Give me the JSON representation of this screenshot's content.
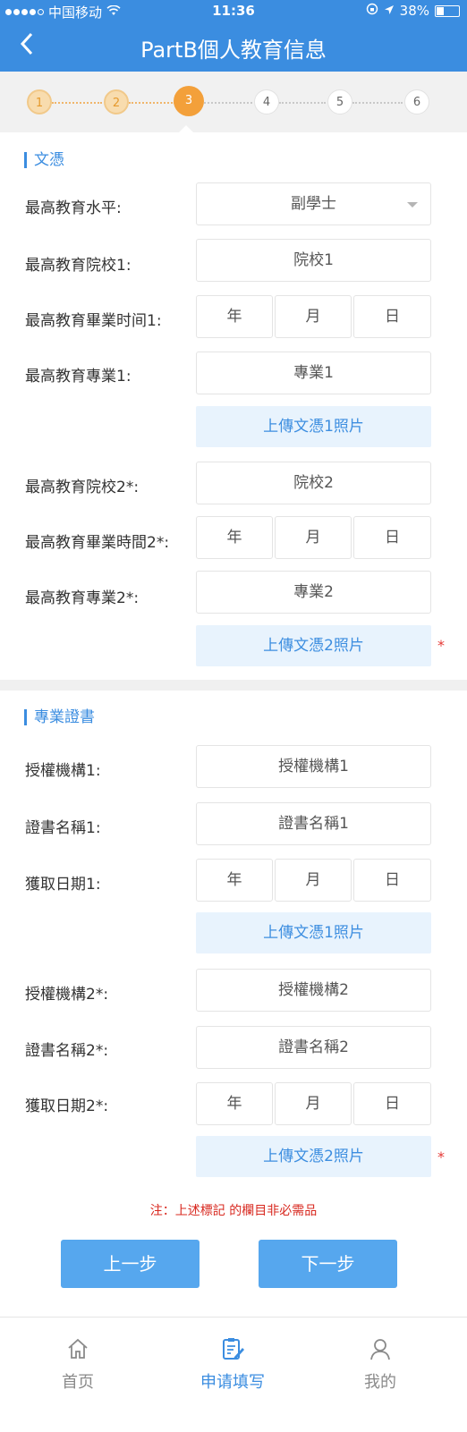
{
  "status_bar": {
    "carrier": "中国移动",
    "time": "11:36",
    "battery": "38%",
    "battery_fraction": 0.38
  },
  "nav": {
    "title": "PartB個人教育信息"
  },
  "steps": [
    "1",
    "2",
    "3",
    "4",
    "5",
    "6"
  ],
  "current_step": 3,
  "education": {
    "section_title": "文憑",
    "level_label": "最高教育水平:",
    "level_value": "副學士",
    "school1_label": "最高教育院校1:",
    "school1_placeholder": "院校1",
    "grad1_label": "最高教育畢業时间1:",
    "major1_label": "最高教育專業1:",
    "major1_placeholder": "專業1",
    "upload1": "上傳文憑1照片",
    "school2_label": "最高教育院校2*:",
    "school2_placeholder": "院校2",
    "grad2_label": "最高教育畢業時間2*:",
    "major2_label": "最高教育專業2*:",
    "major2_placeholder": "專業2",
    "upload2": "上傳文憑2照片"
  },
  "date": {
    "year": "年",
    "month": "月",
    "day": "日"
  },
  "certificate": {
    "section_title": "專業證書",
    "authority1_label": "授權機構1:",
    "authority1_placeholder": "授權機構1",
    "name1_label": "證書名稱1:",
    "name1_placeholder": "證書名稱1",
    "date1_label": "獲取日期1:",
    "upload1": "上傳文憑1照片",
    "authority2_label": "授權機構2*:",
    "authority2_placeholder": "授權機構2",
    "name2_label": "證書名稱2*:",
    "name2_placeholder": "證書名稱2",
    "date2_label": "獲取日期2*:",
    "upload2": "上傳文憑2照片"
  },
  "required_mark": "*",
  "note": "注：上述標記  的欄目非必需品",
  "buttons": {
    "prev": "上一步",
    "next": "下一步"
  },
  "tabbar": {
    "home": "首页",
    "apply": "申请填写",
    "me": "我的"
  },
  "colors": {
    "primary": "#3b8de0",
    "step_active": "#f3a03a",
    "note": "#d8281f"
  }
}
